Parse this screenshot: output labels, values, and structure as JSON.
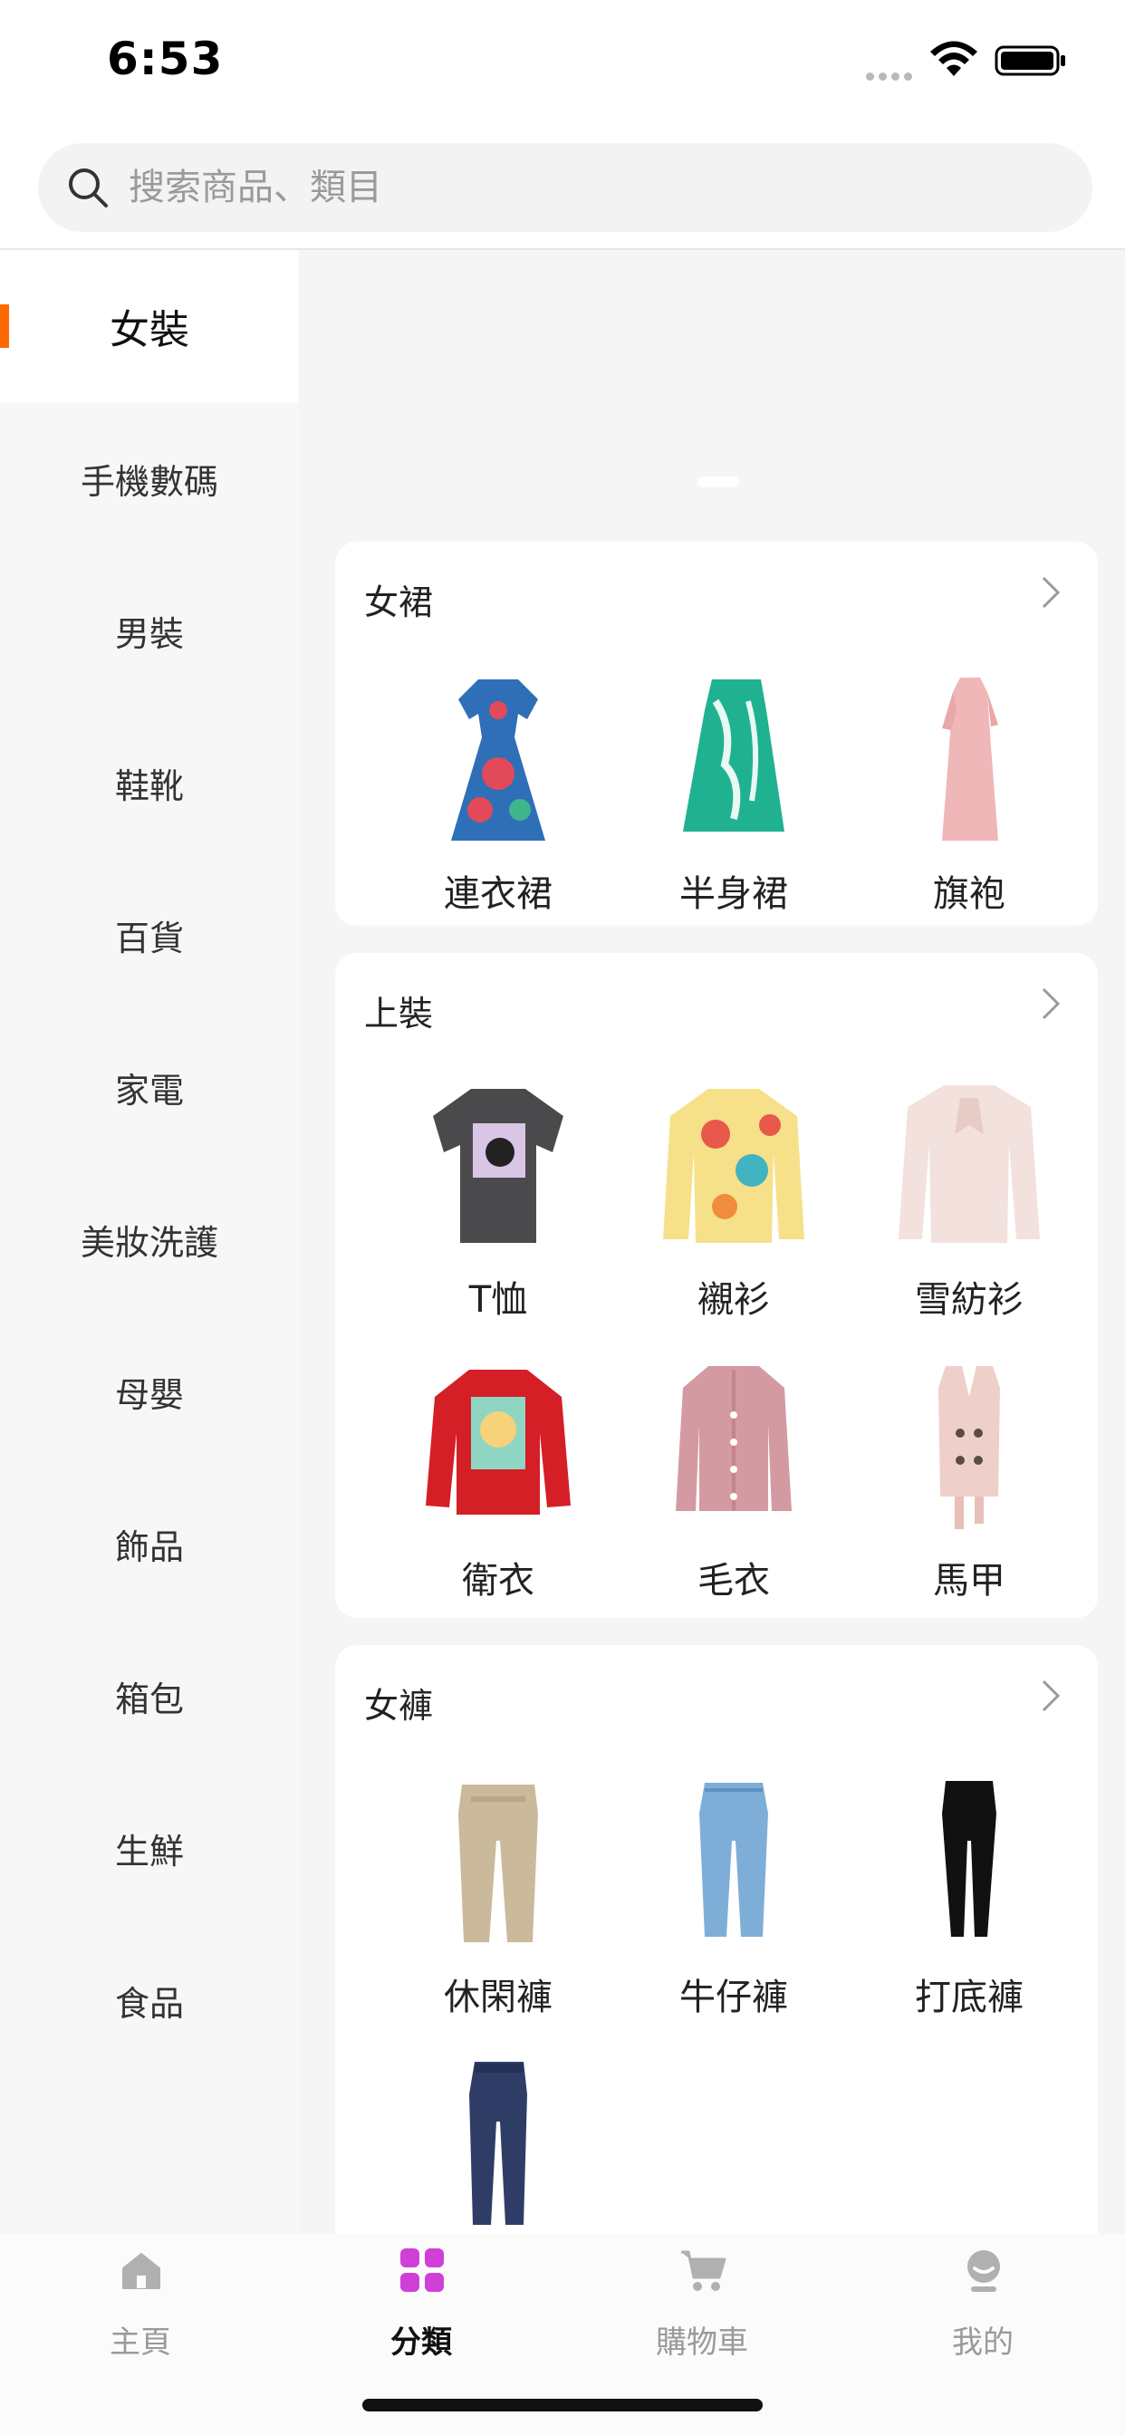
{
  "status_bar": {
    "time": "6:53"
  },
  "search": {
    "placeholder": "搜索商品、類目"
  },
  "sidebar": {
    "items": [
      {
        "label": "女裝",
        "active": true
      },
      {
        "label": "手機數碼"
      },
      {
        "label": "男裝"
      },
      {
        "label": "鞋靴"
      },
      {
        "label": "百貨"
      },
      {
        "label": "家電"
      },
      {
        "label": "美妝洗護"
      },
      {
        "label": "母嬰"
      },
      {
        "label": "飾品"
      },
      {
        "label": "箱包"
      },
      {
        "label": "生鮮"
      },
      {
        "label": "食品"
      }
    ]
  },
  "sections": [
    {
      "title": "女裙",
      "items": [
        {
          "label": "連衣裙"
        },
        {
          "label": "半身裙"
        },
        {
          "label": "旗袍"
        }
      ]
    },
    {
      "title": "上裝",
      "items": [
        {
          "label": "T恤"
        },
        {
          "label": "襯衫"
        },
        {
          "label": "雪紡衫"
        },
        {
          "label": "衛衣"
        },
        {
          "label": "毛衣"
        },
        {
          "label": "馬甲"
        }
      ]
    },
    {
      "title": "女褲",
      "items": [
        {
          "label": "休閑褲"
        },
        {
          "label": "牛仔褲"
        },
        {
          "label": "打底褲"
        },
        {
          "label": ""
        }
      ]
    }
  ],
  "tab_bar": {
    "tabs": [
      {
        "label": "主頁",
        "icon": "home-icon"
      },
      {
        "label": "分類",
        "icon": "grid-icon",
        "active": true
      },
      {
        "label": "購物車",
        "icon": "cart-icon"
      },
      {
        "label": "我的",
        "icon": "profile-icon"
      }
    ]
  },
  "colors": {
    "accent": "#ff6a00",
    "category_icon": "#d03fd6",
    "inactive": "#9a9a9a"
  }
}
